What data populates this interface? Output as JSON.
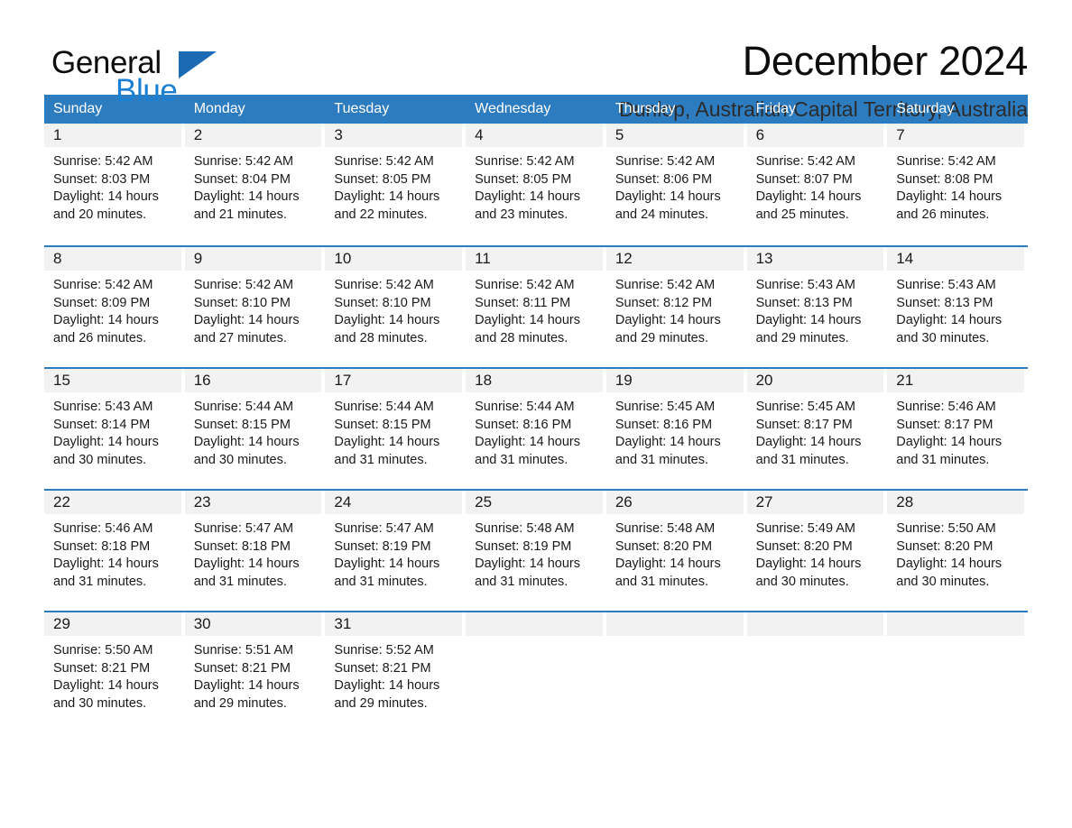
{
  "brand": {
    "name_part1": "General",
    "name_part2": "Blue",
    "triangle_color": "#1b6ab3",
    "blue_color": "#1b7fd4"
  },
  "header": {
    "title": "December 2024",
    "subtitle": "Dunlop, Australian Capital Territory, Australia"
  },
  "theme": {
    "header_blue": "#2e7cc0",
    "daynum_band": "#f2f2f2",
    "text": "#1a1a1a"
  },
  "calendar": {
    "weekday_headers": [
      "Sunday",
      "Monday",
      "Tuesday",
      "Wednesday",
      "Thursday",
      "Friday",
      "Saturday"
    ],
    "weeks": [
      [
        {
          "day": "1",
          "sunrise": "Sunrise: 5:42 AM",
          "sunset": "Sunset: 8:03 PM",
          "daylight": "Daylight: 14 hours and 20 minutes."
        },
        {
          "day": "2",
          "sunrise": "Sunrise: 5:42 AM",
          "sunset": "Sunset: 8:04 PM",
          "daylight": "Daylight: 14 hours and 21 minutes."
        },
        {
          "day": "3",
          "sunrise": "Sunrise: 5:42 AM",
          "sunset": "Sunset: 8:05 PM",
          "daylight": "Daylight: 14 hours and 22 minutes."
        },
        {
          "day": "4",
          "sunrise": "Sunrise: 5:42 AM",
          "sunset": "Sunset: 8:05 PM",
          "daylight": "Daylight: 14 hours and 23 minutes."
        },
        {
          "day": "5",
          "sunrise": "Sunrise: 5:42 AM",
          "sunset": "Sunset: 8:06 PM",
          "daylight": "Daylight: 14 hours and 24 minutes."
        },
        {
          "day": "6",
          "sunrise": "Sunrise: 5:42 AM",
          "sunset": "Sunset: 8:07 PM",
          "daylight": "Daylight: 14 hours and 25 minutes."
        },
        {
          "day": "7",
          "sunrise": "Sunrise: 5:42 AM",
          "sunset": "Sunset: 8:08 PM",
          "daylight": "Daylight: 14 hours and 26 minutes."
        }
      ],
      [
        {
          "day": "8",
          "sunrise": "Sunrise: 5:42 AM",
          "sunset": "Sunset: 8:09 PM",
          "daylight": "Daylight: 14 hours and 26 minutes."
        },
        {
          "day": "9",
          "sunrise": "Sunrise: 5:42 AM",
          "sunset": "Sunset: 8:10 PM",
          "daylight": "Daylight: 14 hours and 27 minutes."
        },
        {
          "day": "10",
          "sunrise": "Sunrise: 5:42 AM",
          "sunset": "Sunset: 8:10 PM",
          "daylight": "Daylight: 14 hours and 28 minutes."
        },
        {
          "day": "11",
          "sunrise": "Sunrise: 5:42 AM",
          "sunset": "Sunset: 8:11 PM",
          "daylight": "Daylight: 14 hours and 28 minutes."
        },
        {
          "day": "12",
          "sunrise": "Sunrise: 5:42 AM",
          "sunset": "Sunset: 8:12 PM",
          "daylight": "Daylight: 14 hours and 29 minutes."
        },
        {
          "day": "13",
          "sunrise": "Sunrise: 5:43 AM",
          "sunset": "Sunset: 8:13 PM",
          "daylight": "Daylight: 14 hours and 29 minutes."
        },
        {
          "day": "14",
          "sunrise": "Sunrise: 5:43 AM",
          "sunset": "Sunset: 8:13 PM",
          "daylight": "Daylight: 14 hours and 30 minutes."
        }
      ],
      [
        {
          "day": "15",
          "sunrise": "Sunrise: 5:43 AM",
          "sunset": "Sunset: 8:14 PM",
          "daylight": "Daylight: 14 hours and 30 minutes."
        },
        {
          "day": "16",
          "sunrise": "Sunrise: 5:44 AM",
          "sunset": "Sunset: 8:15 PM",
          "daylight": "Daylight: 14 hours and 30 minutes."
        },
        {
          "day": "17",
          "sunrise": "Sunrise: 5:44 AM",
          "sunset": "Sunset: 8:15 PM",
          "daylight": "Daylight: 14 hours and 31 minutes."
        },
        {
          "day": "18",
          "sunrise": "Sunrise: 5:44 AM",
          "sunset": "Sunset: 8:16 PM",
          "daylight": "Daylight: 14 hours and 31 minutes."
        },
        {
          "day": "19",
          "sunrise": "Sunrise: 5:45 AM",
          "sunset": "Sunset: 8:16 PM",
          "daylight": "Daylight: 14 hours and 31 minutes."
        },
        {
          "day": "20",
          "sunrise": "Sunrise: 5:45 AM",
          "sunset": "Sunset: 8:17 PM",
          "daylight": "Daylight: 14 hours and 31 minutes."
        },
        {
          "day": "21",
          "sunrise": "Sunrise: 5:46 AM",
          "sunset": "Sunset: 8:17 PM",
          "daylight": "Daylight: 14 hours and 31 minutes."
        }
      ],
      [
        {
          "day": "22",
          "sunrise": "Sunrise: 5:46 AM",
          "sunset": "Sunset: 8:18 PM",
          "daylight": "Daylight: 14 hours and 31 minutes."
        },
        {
          "day": "23",
          "sunrise": "Sunrise: 5:47 AM",
          "sunset": "Sunset: 8:18 PM",
          "daylight": "Daylight: 14 hours and 31 minutes."
        },
        {
          "day": "24",
          "sunrise": "Sunrise: 5:47 AM",
          "sunset": "Sunset: 8:19 PM",
          "daylight": "Daylight: 14 hours and 31 minutes."
        },
        {
          "day": "25",
          "sunrise": "Sunrise: 5:48 AM",
          "sunset": "Sunset: 8:19 PM",
          "daylight": "Daylight: 14 hours and 31 minutes."
        },
        {
          "day": "26",
          "sunrise": "Sunrise: 5:48 AM",
          "sunset": "Sunset: 8:20 PM",
          "daylight": "Daylight: 14 hours and 31 minutes."
        },
        {
          "day": "27",
          "sunrise": "Sunrise: 5:49 AM",
          "sunset": "Sunset: 8:20 PM",
          "daylight": "Daylight: 14 hours and 30 minutes."
        },
        {
          "day": "28",
          "sunrise": "Sunrise: 5:50 AM",
          "sunset": "Sunset: 8:20 PM",
          "daylight": "Daylight: 14 hours and 30 minutes."
        }
      ],
      [
        {
          "day": "29",
          "sunrise": "Sunrise: 5:50 AM",
          "sunset": "Sunset: 8:21 PM",
          "daylight": "Daylight: 14 hours and 30 minutes."
        },
        {
          "day": "30",
          "sunrise": "Sunrise: 5:51 AM",
          "sunset": "Sunset: 8:21 PM",
          "daylight": "Daylight: 14 hours and 29 minutes."
        },
        {
          "day": "31",
          "sunrise": "Sunrise: 5:52 AM",
          "sunset": "Sunset: 8:21 PM",
          "daylight": "Daylight: 14 hours and 29 minutes."
        },
        {
          "day": "",
          "sunrise": "",
          "sunset": "",
          "daylight": ""
        },
        {
          "day": "",
          "sunrise": "",
          "sunset": "",
          "daylight": ""
        },
        {
          "day": "",
          "sunrise": "",
          "sunset": "",
          "daylight": ""
        },
        {
          "day": "",
          "sunrise": "",
          "sunset": "",
          "daylight": ""
        }
      ]
    ]
  }
}
